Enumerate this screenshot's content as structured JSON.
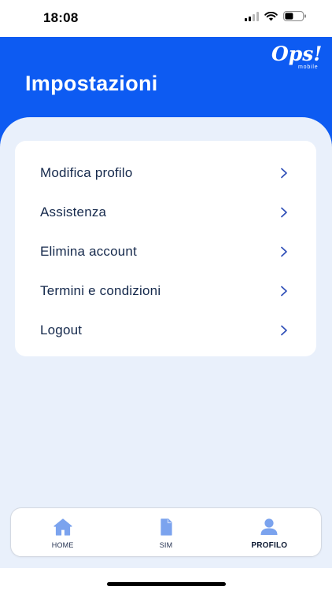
{
  "status_bar": {
    "time": "18:08"
  },
  "header": {
    "title": "Impostazioni",
    "logo_text": "Ops!",
    "logo_sub": "mobile"
  },
  "menu": {
    "items": [
      {
        "label": "Modifica profilo"
      },
      {
        "label": "Assistenza"
      },
      {
        "label": "Elimina account"
      },
      {
        "label": "Termini e condizioni"
      },
      {
        "label": "Logout"
      }
    ]
  },
  "tab_bar": {
    "tabs": [
      {
        "label": "HOME",
        "icon": "home-icon"
      },
      {
        "label": "SIM",
        "icon": "sim-icon"
      },
      {
        "label": "PROFILO",
        "icon": "profile-icon",
        "active": true
      }
    ]
  },
  "colors": {
    "brand": "#0d5bf2",
    "background": "#e9f0fb",
    "text": "#14284b",
    "icon": "#7ba3ee"
  }
}
